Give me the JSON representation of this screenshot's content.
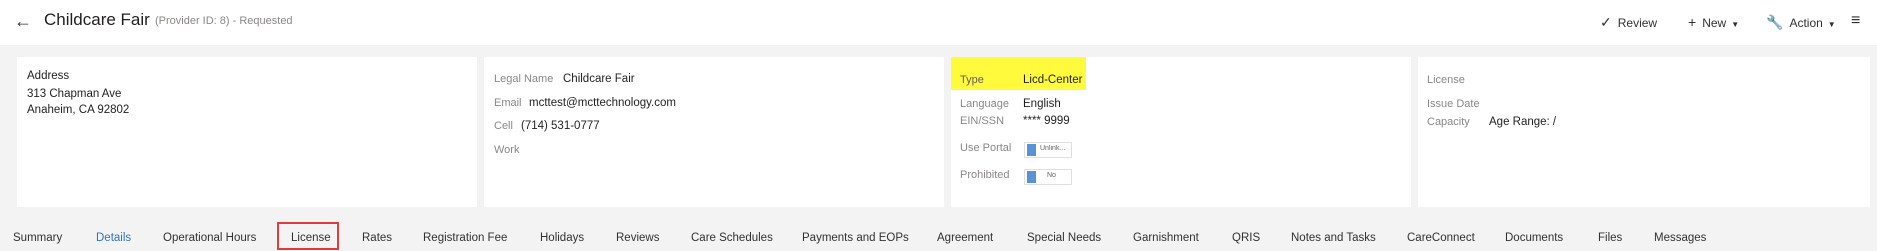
{
  "header": {
    "back_icon": "arrow-left-icon",
    "title": "Childcare Fair",
    "subtitle": "(Provider ID: 8) - Requested",
    "review_label": "Review",
    "new_label": "New",
    "action_label": "Action"
  },
  "address_card": {
    "heading": "Address",
    "line1": "313 Chapman Ave",
    "line2": "Anaheim, CA 92802"
  },
  "contact_card": {
    "legal_name_label": "Legal Name",
    "legal_name": "Childcare Fair",
    "email_label": "Email",
    "email": "mcttest@mcttechnology.com",
    "cell_label": "Cell",
    "cell": "(714) 531-0777",
    "work_label": "Work",
    "work": ""
  },
  "type_card": {
    "type_label": "Type",
    "type": "Licd-Center",
    "highlight_color": "#fffb3c",
    "language_label": "Language",
    "language": "English",
    "ein_label": "EIN/SSN",
    "ein": "**** 9999",
    "use_portal_label": "Use Portal",
    "use_portal_value": "Unlink...",
    "prohibited_label": "Prohibited",
    "prohibited_value": "No"
  },
  "license_card": {
    "license_label": "License",
    "license": "",
    "issue_date_label": "Issue Date",
    "issue_date": "",
    "capacity_label": "Capacity",
    "capacity": "Age Range: /"
  },
  "tabs": {
    "active": "Details",
    "highlighted": "License",
    "items": [
      "Summary",
      "Details",
      "Operational Hours",
      "License",
      "Rates",
      "Registration Fee",
      "Holidays",
      "Reviews",
      "Care Schedules",
      "Payments and EOPs",
      "Agreement",
      "Special Needs",
      "Garnishment",
      "QRIS",
      "Notes and Tasks",
      "CareConnect",
      "Documents",
      "Files",
      "Messages"
    ]
  },
  "colors": {
    "accent": "#2b74c8",
    "highlight_box": "#e03c3c"
  }
}
